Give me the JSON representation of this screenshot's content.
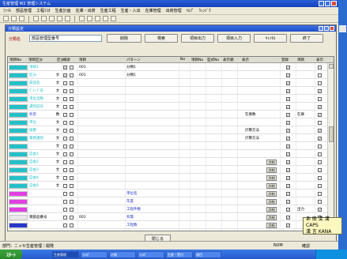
{
  "window": {
    "title": "生産管理 W2 管理システム"
  },
  "menu": [
    "ﾌｧｲﾙ",
    "部品管理",
    "工程ﾏｽﾀ",
    "生産計画",
    "在庫・出荷",
    "生産工程",
    "生産・入出",
    "在庫管理",
    "出荷管理",
    "ﾍﾙﾌﾟ",
    "ｳｨﾝﾄﾞｳ"
  ],
  "child": {
    "title": "分類設定",
    "field_label": "分類名",
    "field_value": "部品管理型番号",
    "buttons": {
      "delete": "削除",
      "search": "検索",
      "output": "項目出力",
      "input": "項目入力",
      "cancel": "ｷｬﾝｾﾙ",
      "done": "終了"
    },
    "close": "閉じる"
  },
  "grid": {
    "headers": [
      "項目No",
      "項目区分",
      "区分",
      "検索",
      "項目",
      "パターン",
      "No",
      "項目No",
      "型式No",
      "表示順",
      "表示",
      "登録",
      "項目",
      "表示"
    ],
    "rows": [
      {
        "color": "#24c0c8",
        "name": "項目1",
        "mark": "",
        "chk1": "✓",
        "t1": "001",
        "t2": "分類1",
        "extra": "",
        "c9": "✓",
        "c10": "",
        "c11": ""
      },
      {
        "color": "#24c0c8",
        "name": "区分",
        "mark": "文",
        "chk1": "✓",
        "t1": "001",
        "t2": "分類1",
        "extra": "",
        "c9": "✓",
        "c10": "",
        "c11": ""
      },
      {
        "color": "#24c0c8",
        "name": "部品名",
        "mark": "文",
        "chk1": "",
        "t1": "",
        "t2": "",
        "extra": "",
        "c9": "✓",
        "c10": "",
        "c11": ""
      },
      {
        "color": "#24c0c8",
        "name": "ｸﾞﾙｰﾌﾟ名",
        "mark": "文",
        "chk1": "",
        "t1": "",
        "t2": "",
        "extra": "",
        "c9": "✓",
        "c10": "",
        "c11": "✓"
      },
      {
        "color": "#24c0c8",
        "name": "単位当数",
        "mark": "文",
        "chk1": "",
        "t1": "",
        "t2": "",
        "extra": "",
        "c9": "✓",
        "c10": "",
        "c11": ""
      },
      {
        "color": "#24c0c8",
        "name": "識別記号",
        "mark": "文",
        "chk1": "",
        "t1": "",
        "t2": "",
        "extra": "",
        "c9": "✓",
        "c10": "",
        "c11": "✓"
      },
      {
        "color": "#24c0c8",
        "name": "数量",
        "mark": "数",
        "chk1": "",
        "t1": "",
        "t2": "",
        "extra": "在庫数",
        "c9": "✓",
        "c10": "在庫",
        "c11": "✓"
      },
      {
        "color": "#24c0c8",
        "name": "単位",
        "mark": "文",
        "chk1": "",
        "t1": "",
        "t2": "",
        "extra": "",
        "c9": "✓",
        "c10": "",
        "c11": ""
      },
      {
        "color": "#24c0c8",
        "name": "換算",
        "mark": "文",
        "chk1": "",
        "t1": "",
        "t2": "",
        "extra": "計算方法",
        "c9": "✓",
        "c10": "",
        "c11": "✓"
      },
      {
        "color": "#24c0c8",
        "name": "業務識別",
        "mark": "文",
        "chk1": "",
        "t1": "",
        "t2": "",
        "extra": "計算方法",
        "c9": "✓",
        "c10": "",
        "c11": "✓"
      },
      {
        "color": "#24c0c8",
        "name": "",
        "mark": "文",
        "chk1": "",
        "t1": "",
        "t2": "",
        "extra": "",
        "c9": "✓",
        "c10": "",
        "c11": ""
      },
      {
        "color": "#24c0c8",
        "name": "自由1",
        "mark": "文",
        "chk1": "",
        "t1": "",
        "t2": "",
        "extra": "",
        "c9": "✓",
        "c10": "",
        "c11": ""
      },
      {
        "color": "#24c0c8",
        "name": "自由2",
        "mark": "文",
        "chk1": "",
        "t1": "",
        "t2": "",
        "extra": "",
        "c9": "✓",
        "c10": "",
        "c11": ""
      },
      {
        "color": "#24c0c8",
        "name": "自由3",
        "mark": "文",
        "chk1": "",
        "t1": "",
        "t2": "",
        "extra": "",
        "c9": "✓",
        "c10": "",
        "c11": ""
      },
      {
        "color": "#24c0c8",
        "name": "自由4",
        "mark": "文",
        "chk1": "",
        "t1": "",
        "t2": "",
        "extra": "",
        "c9": "✓",
        "c10": "",
        "c11": ""
      },
      {
        "color": "#24c0c8",
        "name": "自由5",
        "mark": "文",
        "chk1": "",
        "t1": "",
        "t2": "",
        "extra": "",
        "c9": "✓",
        "c10": "",
        "c11": ""
      },
      {
        "color": "#e040e0",
        "name": "",
        "mark": "",
        "chk1": "",
        "t1": "",
        "t2": "単位名",
        "extra": "",
        "c9": "✓",
        "c10": "",
        "c11": ""
      },
      {
        "color": "#e040e0",
        "name": "",
        "mark": "",
        "chk1": "",
        "t1": "",
        "t2": "年度",
        "extra": "",
        "c9": "✓",
        "c10": "",
        "c11": ""
      },
      {
        "color": "#e040e0",
        "name": "",
        "mark": "",
        "chk1": "",
        "t1": "",
        "t2": "工程件数",
        "extra": "",
        "c9": "✓",
        "c10": "出力",
        "c11": "✓"
      },
      {
        "color": "#e8e8e8",
        "name": "親部品番号",
        "mark": "",
        "chk1": "",
        "t1": "001",
        "t2": "有無",
        "extra": "",
        "c9": "✓",
        "c10": "",
        "c11": ""
      },
      {
        "color": "#2838c8",
        "name": "",
        "mark": "",
        "chk1": "",
        "t1": "",
        "t2": "工程数",
        "extra": "",
        "c9": "✓",
        "c10": "",
        "c11": ""
      }
    ],
    "detail_label": "詳細"
  },
  "status": {
    "left": "部門：ニッセ生産管理｜開発",
    "mid": "NUM",
    "right": "確認"
  },
  "taskbar": {
    "start": "ｽﾀｰﾄ",
    "tasks": [
      "生産管理",
      "ﾌｫﾙﾀﾞ",
      "ﾒﾓ帳",
      "ﾌｫﾙﾀﾞ",
      "生産・受付",
      "項目"
    ]
  },
  "ime": {
    "line1": "あ 般 変 漢 CAPS",
    "line2": "漢 言 KANA"
  }
}
